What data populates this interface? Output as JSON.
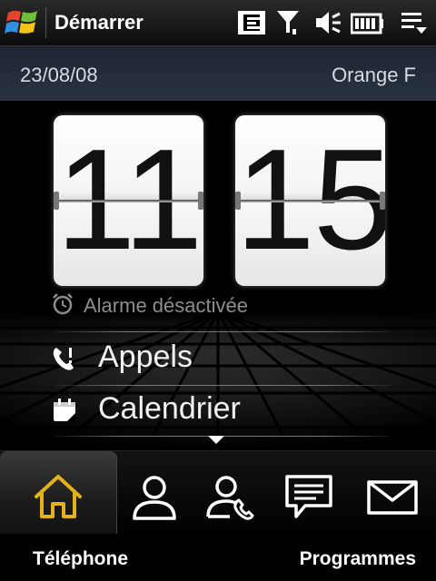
{
  "topbar": {
    "start_label": "Démarrer",
    "icons": [
      "windows-logo",
      "phone-status-icon",
      "signal-icon",
      "volume-icon",
      "battery-icon",
      "menu-icon"
    ]
  },
  "infobar": {
    "date": "23/08/08",
    "operator": "Orange F"
  },
  "clock": {
    "hours": "11",
    "minutes": "15"
  },
  "alarm": {
    "label": "Alarme désactivée",
    "icon": "alarm-clock-icon"
  },
  "list": [
    {
      "label": "Appels",
      "icon": "call-history-icon"
    },
    {
      "label": "Calendrier",
      "icon": "calendar-icon"
    }
  ],
  "tabs": [
    {
      "icon": "home-icon",
      "selected": true
    },
    {
      "icon": "contact-icon"
    },
    {
      "icon": "phonebook-icon"
    },
    {
      "icon": "message-icon"
    },
    {
      "icon": "email-icon"
    }
  ],
  "softkeys": {
    "left": "Téléphone",
    "right": "Programmes"
  },
  "colors": {
    "accent_home": "#e3b21a",
    "info_bar": "#232b38",
    "background": "#000000"
  }
}
